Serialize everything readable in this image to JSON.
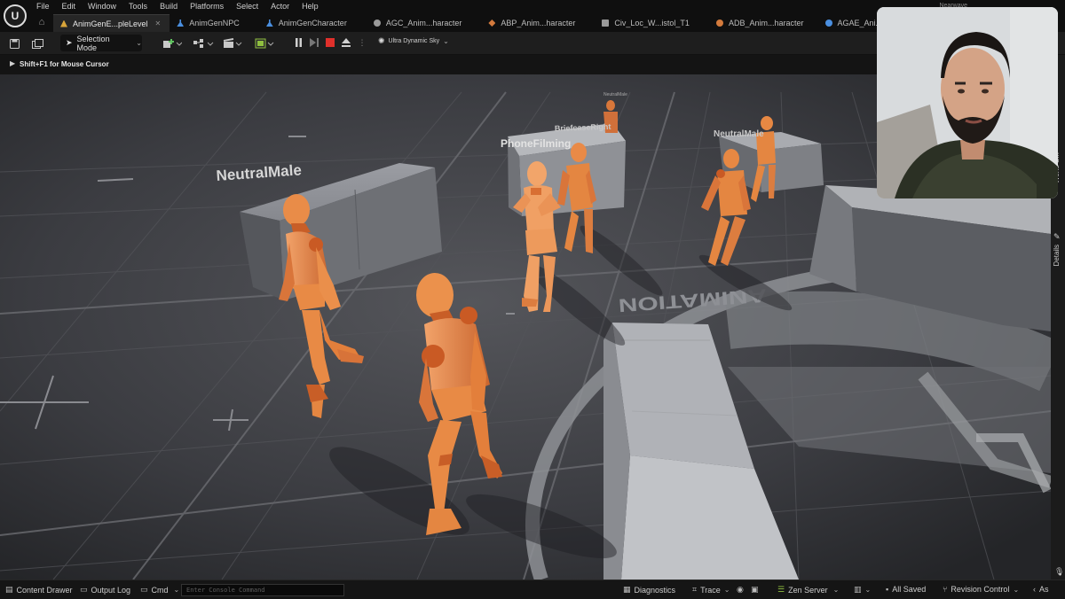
{
  "menu": [
    "File",
    "Edit",
    "Window",
    "Tools",
    "Build",
    "Platforms",
    "Select",
    "Actor",
    "Help"
  ],
  "tabs": [
    {
      "label": "AnimGenE...pleLevel",
      "active": true,
      "color": "#d9a53a"
    },
    {
      "label": "AnimGenNPC",
      "active": false,
      "color": "#4a8fe0"
    },
    {
      "label": "AnimGenCharacter",
      "active": false,
      "color": "#4a8fe0"
    },
    {
      "label": "AGC_Anim...haracter",
      "active": false,
      "color": "#9a9a9a"
    },
    {
      "label": "ABP_Anim...haracter",
      "active": false,
      "color": "#d37a3c"
    },
    {
      "label": "Civ_Loc_W...istol_T1",
      "active": false,
      "color": "#9a9a9a"
    },
    {
      "label": "ADB_Anim...haracter",
      "active": false,
      "color": "#d37a3c"
    },
    {
      "label": "AGAE_Ani...Character",
      "active": false,
      "color": "#4a8fe0"
    }
  ],
  "top_right_text": "Nearwave",
  "toolbar": {
    "mode_label": "Selection Mode",
    "sky_label": "Ultra Dynamic Sky"
  },
  "viewport": {
    "hint": "Shift+F1 for Mouse Cursor",
    "labels": [
      "NeutralMale",
      "PhoneFilming",
      "BriefcaseRight",
      "NeutralMale",
      "NeutralMale"
    ],
    "floor_text": "ANIMATION"
  },
  "right_dock": {
    "tab1": "World S...",
    "tab2": "Details"
  },
  "statusbar": {
    "content_drawer": "Content Drawer",
    "output_log": "Output Log",
    "cmd": "Cmd",
    "console_placeholder": "Enter Console Command",
    "diagnostics": "Diagnostics",
    "trace": "Trace",
    "zen_server": "Zen Server",
    "all_saved": "All Saved",
    "revision_control": "Revision Control",
    "as": "As"
  },
  "colors": {
    "mannequin": "#e88a45",
    "mannequin_shade": "#b8582a",
    "joint": "#c95a24",
    "floor": "#3b3c40",
    "block": "#8e9096"
  }
}
